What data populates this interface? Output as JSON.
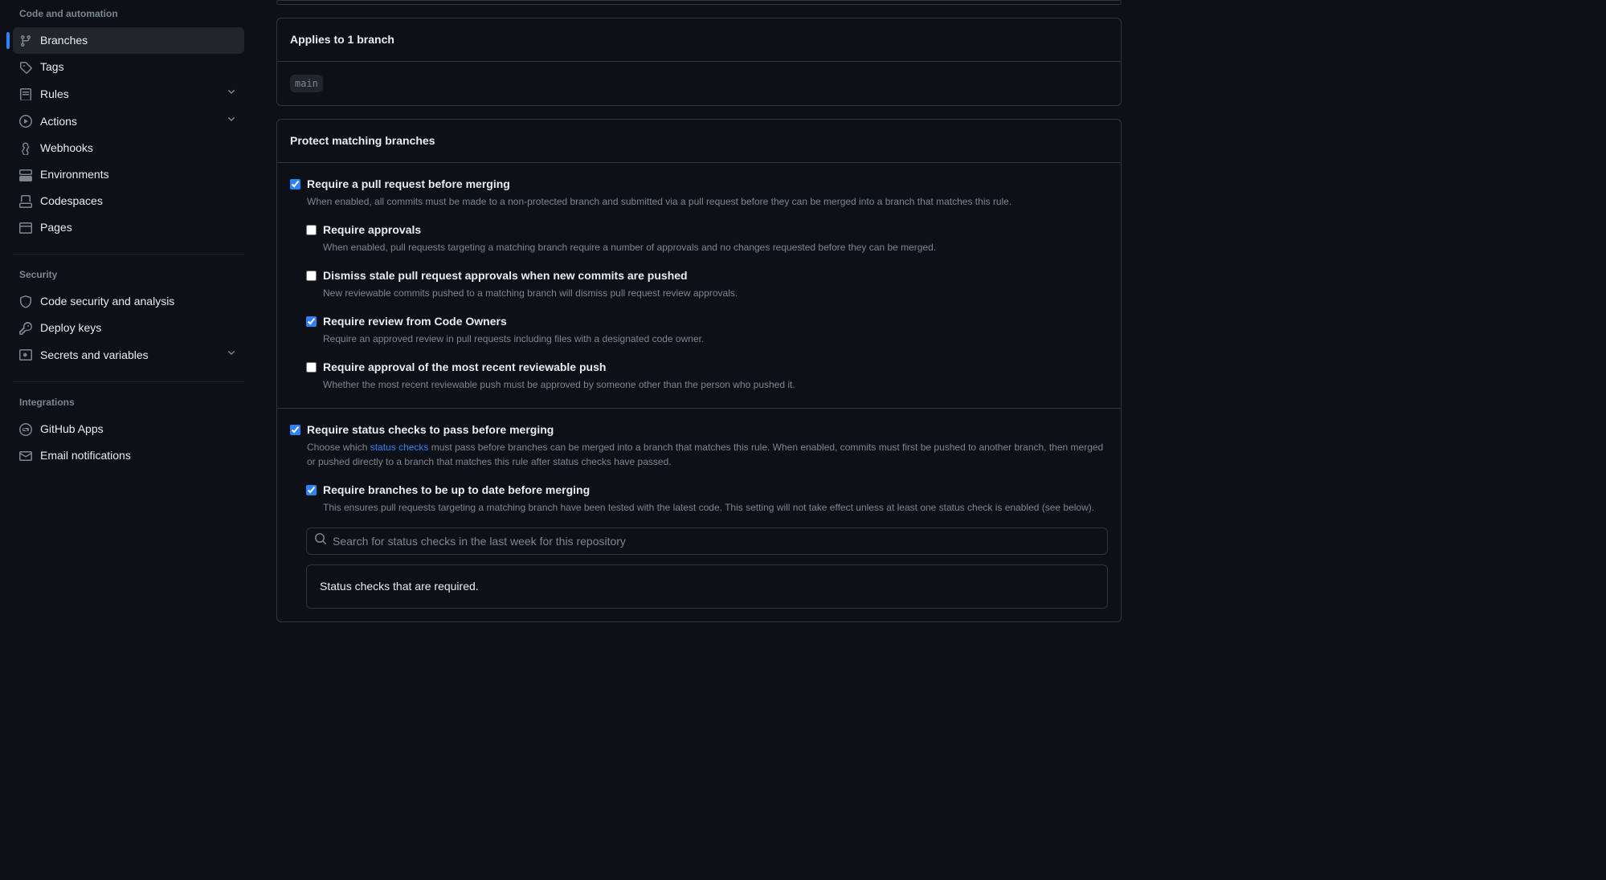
{
  "sidebar": {
    "sections": {
      "code_automation": {
        "title": "Code and automation",
        "items": [
          {
            "label": "Branches",
            "active": true
          },
          {
            "label": "Tags"
          },
          {
            "label": "Rules",
            "expandable": true
          },
          {
            "label": "Actions",
            "expandable": true
          },
          {
            "label": "Webhooks"
          },
          {
            "label": "Environments"
          },
          {
            "label": "Codespaces"
          },
          {
            "label": "Pages"
          }
        ]
      },
      "security": {
        "title": "Security",
        "items": [
          {
            "label": "Code security and analysis"
          },
          {
            "label": "Deploy keys"
          },
          {
            "label": "Secrets and variables",
            "expandable": true
          }
        ]
      },
      "integrations": {
        "title": "Integrations",
        "items": [
          {
            "label": "GitHub Apps"
          },
          {
            "label": "Email notifications"
          }
        ]
      }
    }
  },
  "applies_to": {
    "title": "Applies to 1 branch",
    "branch": "main"
  },
  "protect": {
    "heading": "Protect matching branches",
    "rules": {
      "require_pr": {
        "title": "Require a pull request before merging",
        "desc": "When enabled, all commits must be made to a non-protected branch and submitted via a pull request before they can be merged into a branch that matches this rule.",
        "checked": true
      },
      "require_approvals": {
        "title": "Require approvals",
        "desc": "When enabled, pull requests targeting a matching branch require a number of approvals and no changes requested before they can be merged.",
        "checked": false
      },
      "dismiss_stale": {
        "title": "Dismiss stale pull request approvals when new commits are pushed",
        "desc": "New reviewable commits pushed to a matching branch will dismiss pull request review approvals.",
        "checked": false
      },
      "code_owners": {
        "title": "Require review from Code Owners",
        "desc": "Require an approved review in pull requests including files with a designated code owner.",
        "checked": true
      },
      "most_recent": {
        "title": "Require approval of the most recent reviewable push",
        "desc": "Whether the most recent reviewable push must be approved by someone other than the person who pushed it.",
        "checked": false
      },
      "status_checks": {
        "title": "Require status checks to pass before merging",
        "desc_prefix": "Choose which ",
        "desc_link": "status checks",
        "desc_suffix": " must pass before branches can be merged into a branch that matches this rule. When enabled, commits must first be pushed to another branch, then merged or pushed directly to a branch that matches this rule after status checks have passed.",
        "checked": true
      },
      "branches_up_to_date": {
        "title": "Require branches to be up to date before merging",
        "desc": "This ensures pull requests targeting a matching branch have been tested with the latest code. This setting will not take effect unless at least one status check is enabled (see below).",
        "checked": true
      }
    },
    "search": {
      "placeholder": "Search for status checks in the last week for this repository"
    },
    "status_required": "Status checks that are required."
  }
}
